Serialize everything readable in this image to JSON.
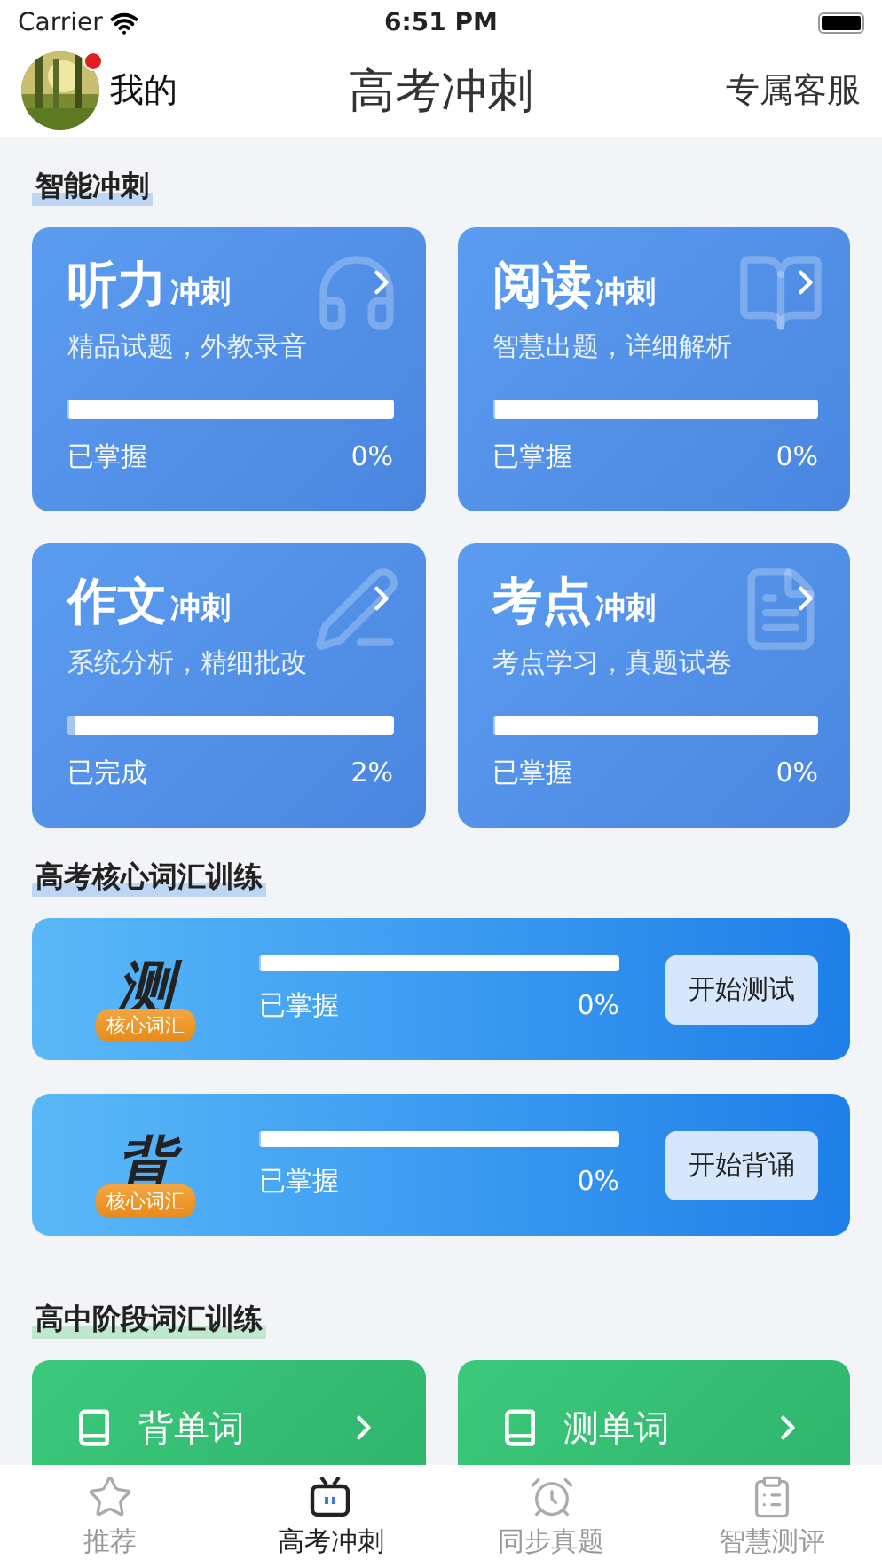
{
  "status_bar": {
    "carrier": "Carrier",
    "time": "6:51 PM"
  },
  "header": {
    "profile_label": "我的",
    "has_notification": true,
    "title": "高考冲刺",
    "service_link": "专属客服"
  },
  "sections": [
    {
      "kind": "grid",
      "title": "智能冲刺",
      "cards": [
        {
          "title_main": "听力",
          "title_sub": "冲刺",
          "subtitle": "精品试题，外教录音",
          "level": 0,
          "status": "已掌握",
          "percent": "0%"
        },
        {
          "title_main": "阅读",
          "title_sub": "冲刺",
          "subtitle": "智慧出题，详细解析",
          "level": 0,
          "status": "已掌握",
          "percent": "0%"
        },
        {
          "title_main": "作文",
          "title_sub": "冲刺",
          "subtitle": "系统分析，精细批改",
          "level": 0.02,
          "status": "已完成",
          "percent": "2%"
        },
        {
          "title_main": "考点",
          "title_sub": "冲刺",
          "subtitle": "考点学习，真题试卷",
          "level": 0,
          "status": "已掌握",
          "percent": "0%"
        }
      ]
    },
    {
      "kind": "rows",
      "title": "高考核心词汇训练",
      "rows": [
        {
          "badge_char": "测",
          "badge_label": "核心词汇",
          "level": 0,
          "status": "已掌握",
          "percent": "0%",
          "button": "开始测试"
        },
        {
          "badge_char": "背",
          "badge_label": "核心词汇",
          "level": 0,
          "status": "已掌握",
          "percent": "0%",
          "button": "开始背诵"
        }
      ]
    },
    {
      "kind": "tiles",
      "title": "高中阶段词汇训练",
      "tiles": [
        {
          "label": "背单词"
        },
        {
          "label": "测单词"
        }
      ]
    }
  ],
  "tab_bar": [
    {
      "label": "推荐",
      "selected": false
    },
    {
      "label": "高考冲刺",
      "selected": true
    },
    {
      "label": "同步真题",
      "selected": false
    },
    {
      "label": "智慧测评",
      "selected": false
    }
  ]
}
